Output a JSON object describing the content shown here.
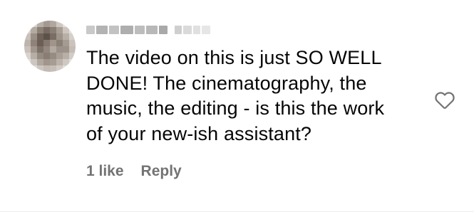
{
  "comment": {
    "text": "The video on this is just SO WELL\nDONE! The cinematography, the\nmusic, the editing - is this the work\nof your new-ish assistant?",
    "likes_label": "1 like",
    "reply_label": "Reply",
    "like_icon": "heart-outline-icon"
  },
  "colors": {
    "text": "#050505",
    "secondary_text": "#737373",
    "icon_stroke": "#737373",
    "background": "#ffffff"
  }
}
